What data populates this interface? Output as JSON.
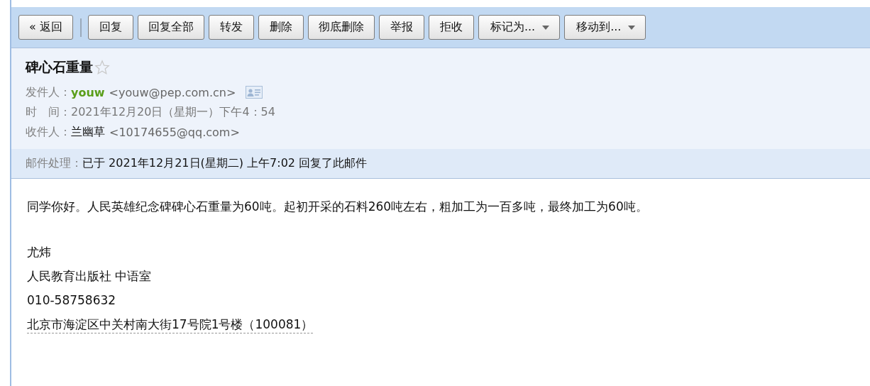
{
  "toolbar": {
    "buttons": [
      {
        "label": "« 返回",
        "kind": "back"
      },
      {
        "label": "回复",
        "kind": "plain"
      },
      {
        "label": "回复全部",
        "kind": "plain"
      },
      {
        "label": "转发",
        "kind": "plain"
      },
      {
        "label": "删除",
        "kind": "plain"
      },
      {
        "label": "彻底删除",
        "kind": "plain"
      },
      {
        "label": "举报",
        "kind": "plain"
      },
      {
        "label": "拒收",
        "kind": "plain"
      },
      {
        "label": "标记为...",
        "kind": "dropdown"
      },
      {
        "label": "移动到...",
        "kind": "dropdown"
      }
    ]
  },
  "header": {
    "subject": "碑心石重量",
    "starred": false,
    "fields": [
      {
        "label": "发件人：",
        "name": "youw",
        "value": "<youw@pep.com.cn>",
        "kind": "sender"
      },
      {
        "label": "时　间：",
        "value": "2021年12月20日（星期一）下午4：54",
        "kind": "time"
      },
      {
        "label": "收件人：",
        "name": "兰幽草",
        "value": "<10174655@qq.com>",
        "kind": "recipient"
      }
    ]
  },
  "processing": {
    "label": "邮件处理：",
    "text": "已于 2021年12月21日(星期二) 上午7:02 回复了此邮件"
  },
  "body": {
    "text": "同学你好。人民英雄纪念碑碑心石重量为60吨。起初开采的石料260吨左右，粗加工为一百多吨，最终加工为60吨。",
    "signature": [
      {
        "text": "尤炜",
        "kind": "plain"
      },
      {
        "text": "人民教育出版社 中语室",
        "kind": "plain"
      },
      {
        "text": "010-58758632",
        "kind": "plain"
      },
      {
        "text": "北京市海淀区中关村南大街17号院1号楼（100081）",
        "kind": "address"
      }
    ]
  }
}
